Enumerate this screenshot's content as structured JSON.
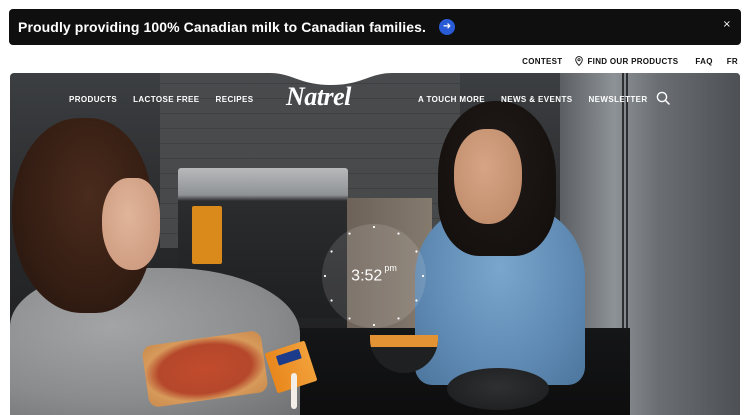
{
  "banner": {
    "text": "Proudly providing 100% Canadian milk to Canadian families.",
    "arrow_icon": "arrow-right-icon",
    "close_symbol": "×",
    "accent_color": "#2a5bd7"
  },
  "utility_nav": {
    "contest": "CONTEST",
    "find_products": "FIND OUR PRODUCTS",
    "faq": "FAQ",
    "language": "FR"
  },
  "main_nav": {
    "left": [
      "PRODUCTS",
      "LACTOSE FREE",
      "RECIPES"
    ],
    "right": [
      "A TOUCH MORE",
      "NEWS & EVENTS",
      "NEWSLETTER"
    ],
    "logo": "Natrel",
    "search_icon": "search-icon"
  },
  "hero": {
    "clock_time": "3:52",
    "clock_period": "pm"
  }
}
